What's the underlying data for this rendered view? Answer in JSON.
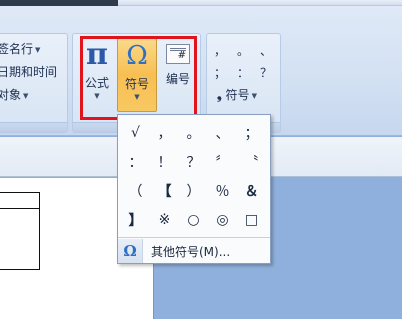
{
  "ribbon": {
    "group_left": {
      "items": [
        {
          "label": "签名行",
          "has_dropdown": true
        },
        {
          "label": "日期和时间",
          "has_dropdown": false
        },
        {
          "label": "对象",
          "has_dropdown": true
        }
      ]
    },
    "formula_button": {
      "icon": "π",
      "label": "公式"
    },
    "symbol_button": {
      "icon": "Ω",
      "label": "符号",
      "pressed": true
    },
    "numbering_button": {
      "icon_text": "#",
      "label": "编号"
    },
    "quick_symbols": {
      "row1": [
        "，",
        "。",
        "、"
      ],
      "row2": [
        "；",
        "：",
        "？"
      ],
      "dropdown": {
        "icon": "❟",
        "label": "符号"
      }
    }
  },
  "symbol_dropdown": {
    "symbols": [
      "√",
      "，",
      "。",
      "、",
      "；",
      "：",
      "！",
      "？",
      "〞",
      "〝",
      "（",
      "【",
      "）",
      "％",
      "＆",
      "】",
      "※",
      "○",
      "◎",
      "□"
    ],
    "more_symbols": {
      "icon": "Ω",
      "label": "其他符号(M)..."
    }
  },
  "colors": {
    "highlight": "#e0151b",
    "pressed": "#f7bf52",
    "workspace": "#8fb0dc"
  }
}
